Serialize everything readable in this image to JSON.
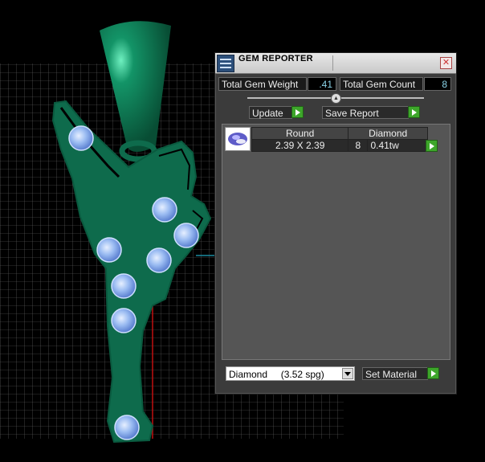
{
  "window": {
    "title": "GEM REPORTER",
    "close_icon": "close-icon",
    "app_icon": "gem-reporter-icon"
  },
  "totals": {
    "weight_label": "Total Gem Weight",
    "weight_value": ".41",
    "count_label": "Total Gem Count",
    "count_value": "8"
  },
  "actions": {
    "update_label": "Update",
    "save_report_label": "Save Report"
  },
  "gem_table": {
    "headers": [
      "Round",
      "Diamond"
    ],
    "rows": [
      {
        "size": "2.39 X 2.39",
        "count": "8",
        "weight": "0.41tw"
      }
    ]
  },
  "material": {
    "selected": "Diamond     (3.52 spg)",
    "set_label": "Set Material"
  },
  "colors": {
    "model_green": "#0e6b4c",
    "gem_blue": "#8fb1ef",
    "accent_green": "#3da62a",
    "value_cyan": "#8ad3e8"
  }
}
